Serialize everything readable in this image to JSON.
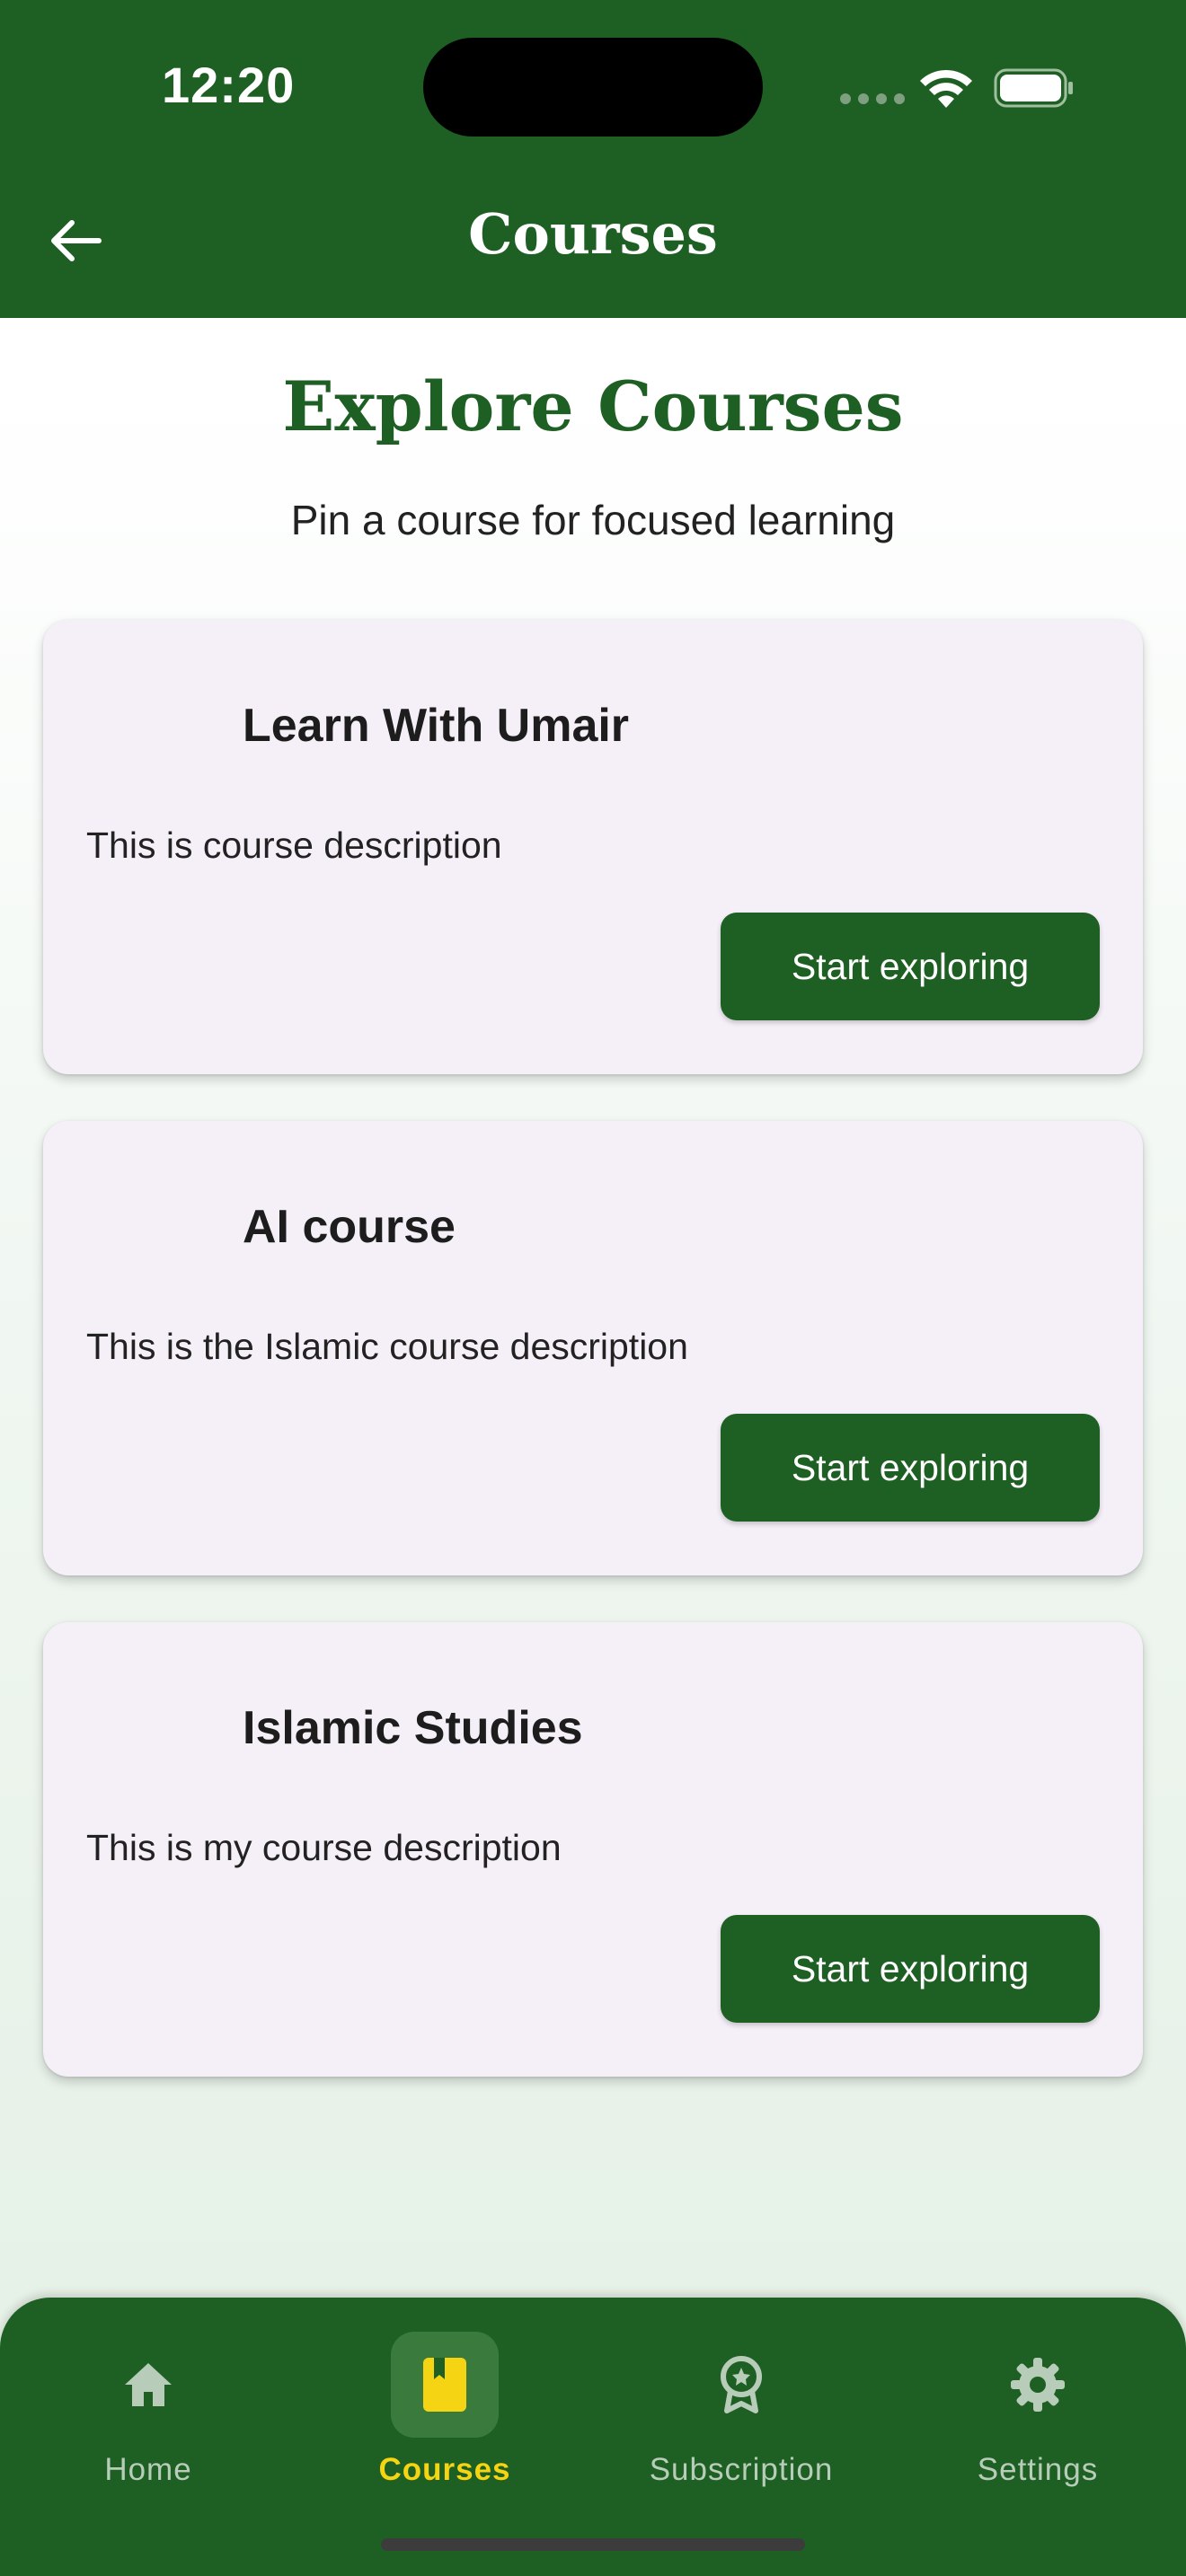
{
  "status_bar": {
    "time": "12:20"
  },
  "app_bar": {
    "title": "Courses"
  },
  "header": {
    "title": "Explore Courses",
    "subtitle": "Pin a course for focused learning"
  },
  "courses": [
    {
      "title": "Learn With Umair",
      "description": "This is course description",
      "button_label": "Start exploring"
    },
    {
      "title": "AI course",
      "description": "This is the Islamic course description",
      "button_label": "Start exploring"
    },
    {
      "title": "Islamic Studies",
      "description": "This is my course description",
      "button_label": "Start exploring"
    }
  ],
  "bottom_nav": {
    "items": [
      {
        "label": "Home",
        "icon": "home-icon"
      },
      {
        "label": "Courses",
        "icon": "book-icon",
        "active": true
      },
      {
        "label": "Subscription",
        "icon": "award-icon"
      },
      {
        "label": "Settings",
        "icon": "gear-icon"
      }
    ]
  },
  "colors": {
    "primary": "#1e5f23",
    "accent": "#f5d413",
    "card_bg": "#f5f0f8"
  }
}
